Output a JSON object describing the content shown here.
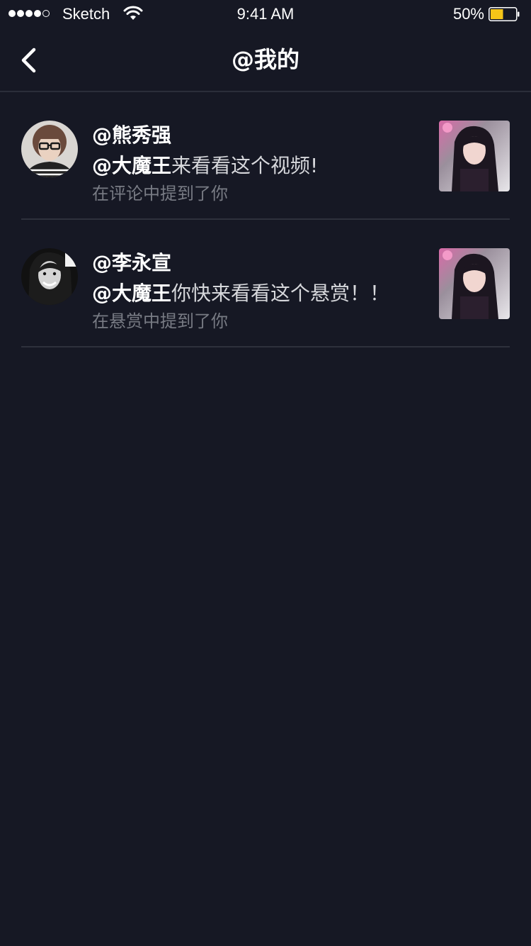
{
  "status_bar": {
    "carrier": "Sketch",
    "time": "9:41 AM",
    "battery_percent": "50%",
    "battery_level": 0.5,
    "signal_bars_filled": 4,
    "signal_bars_total": 5
  },
  "nav": {
    "title": "@我的",
    "back_icon": "chevron-left-icon"
  },
  "mentions": [
    {
      "username": "@熊秀强",
      "mention": "@大魔王",
      "message": "来看看这个视频!",
      "context": "在评论中提到了你"
    },
    {
      "username": "@李永宣",
      "mention": "@大魔王",
      "message": "你快来看看这个悬赏！！",
      "context": "在悬赏中提到了你"
    }
  ],
  "colors": {
    "background": "#161824",
    "divider": "#2e313c",
    "primary_text": "#ffffff",
    "secondary_text": "#d6d7db",
    "muted_text": "#787b84",
    "battery_fill": "#f5c518"
  }
}
